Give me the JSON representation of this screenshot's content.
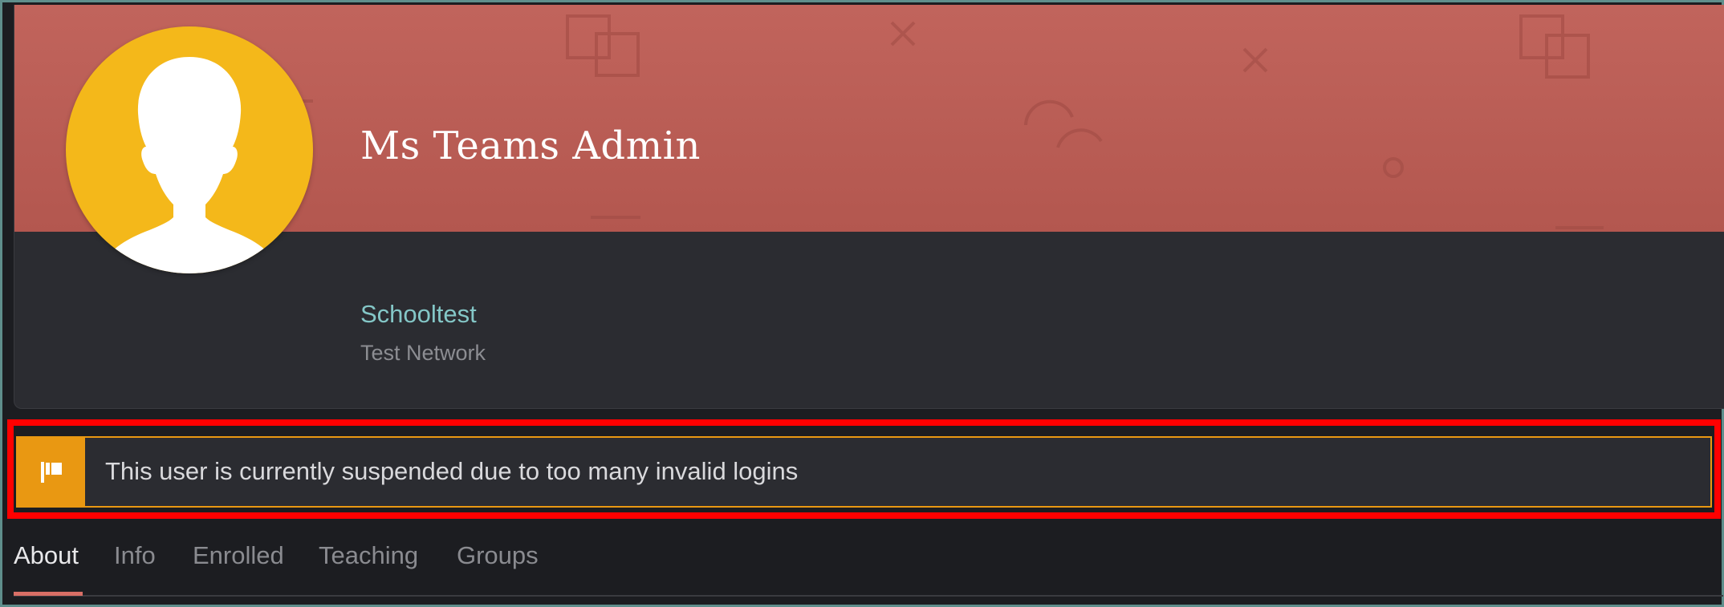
{
  "profile": {
    "name": "Ms Teams Admin",
    "organization": "Schooltest",
    "network": "Test Network",
    "avatar_icon": "user-silhouette-icon",
    "banner_color": "#c1645c",
    "avatar_color": "#f4b81a"
  },
  "alert": {
    "icon": "flag-icon",
    "message": "This user is currently suspended due to too many invalid logins",
    "accent_color": "#e99812"
  },
  "tabs": [
    {
      "label": "About",
      "active": true
    },
    {
      "label": "Info",
      "active": false
    },
    {
      "label": "Enrolled",
      "active": false
    },
    {
      "label": "Teaching",
      "active": false
    },
    {
      "label": "Groups",
      "active": false
    }
  ]
}
